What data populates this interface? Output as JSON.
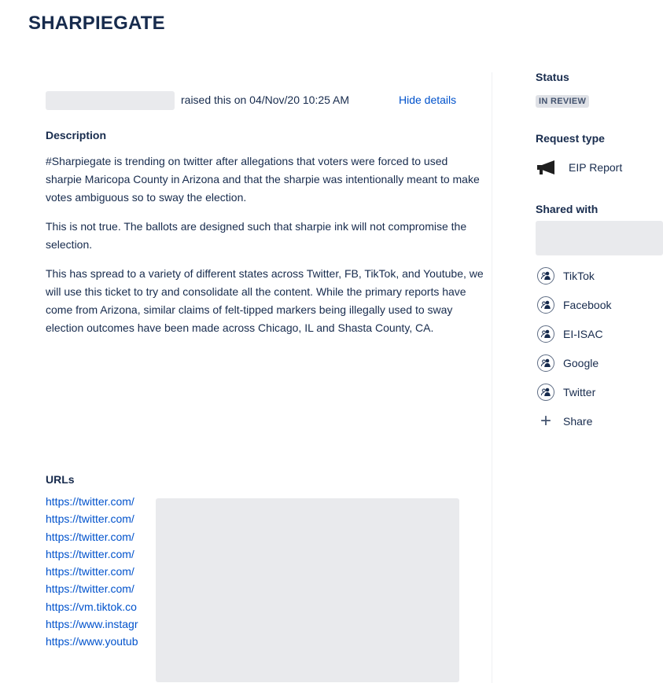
{
  "page": {
    "title": "SHARPIEGATE"
  },
  "issue": {
    "raised_text": "raised this on 04/Nov/20 10:25 AM",
    "hide_details_label": "Hide details",
    "description_heading": "Description",
    "description_paragraphs": [
      "#Sharpiegate is trending on twitter after allegations that voters were forced to used sharpie Maricopa County in Arizona and that the sharpie was intentionally meant to make votes ambiguous so to sway the election.",
      "This is not true. The ballots are designed such that sharpie ink will not compromise the selection.",
      "This has spread to a variety of different states across Twitter, FB, TikTok, and Youtube, we will use this ticket to try and consolidate all the content. While the primary reports have come from Arizona, similar claims of felt-tipped markers being illegally used to sway election outcomes have been made across Chicago, IL and Shasta County, CA."
    ],
    "urls_heading": "URLs",
    "urls": [
      "https://twitter.com/",
      "https://twitter.com/",
      "https://twitter.com/",
      "https://twitter.com/",
      "https://twitter.com/",
      "https://twitter.com/",
      "https://vm.tiktok.co",
      "https://www.instagr",
      "https://www.youtub"
    ]
  },
  "sidebar": {
    "status_heading": "Status",
    "status_value": "IN REVIEW",
    "request_type_heading": "Request type",
    "request_type_value": "EIP Report",
    "request_type_icon": "megaphone-icon",
    "shared_with_heading": "Shared with",
    "organizations": [
      {
        "name": "TikTok",
        "icon": "organization-icon"
      },
      {
        "name": "Facebook",
        "icon": "organization-icon"
      },
      {
        "name": "EI-ISAC",
        "icon": "organization-icon"
      },
      {
        "name": "Google",
        "icon": "organization-icon"
      },
      {
        "name": "Twitter",
        "icon": "organization-icon"
      }
    ],
    "share_label": "Share"
  },
  "colors": {
    "link": "#0052cc",
    "text": "#172b4d",
    "badge_bg": "#dfe1e6"
  }
}
